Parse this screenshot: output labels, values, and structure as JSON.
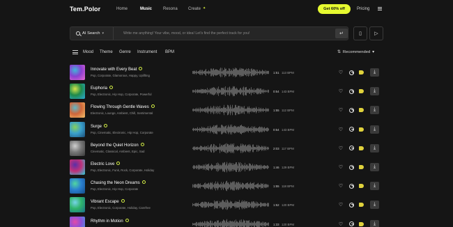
{
  "header": {
    "logo": "Tem.Polor",
    "nav": [
      "Home",
      "Music",
      "Resona",
      "Create"
    ],
    "active_nav": "Music",
    "promo": "Get 60% off",
    "pricing": "Pricing"
  },
  "search": {
    "mode": "AI Search",
    "placeholder": "Write me anything! Your vibe, mood, or idea! Let's find the perfect track for you!"
  },
  "filters": [
    "Mood",
    "Theme",
    "Genre",
    "Instrument",
    "BPM"
  ],
  "sort": "Recommended",
  "tracks": [
    {
      "title": "Innovate with Every Beat",
      "tags": "Pop, Corporate, Glamorous, Happy, Uplifting",
      "duration": "1:51",
      "bpm": "113 BPM",
      "cover": [
        "#8a3fd1",
        "#3fb8d8",
        "#e86bd0"
      ]
    },
    {
      "title": "Euphoria",
      "tags": "Pop, Electronic, Hip Hop, Corporate, Powerful",
      "duration": "0:54",
      "bpm": "143 BPM",
      "cover": [
        "#1f8a4a",
        "#d4e44a",
        "#2aa8d6"
      ]
    },
    {
      "title": "Flowing Through Gentle Waves",
      "tags": "Electronic, Lounge, Ambient, Chill, Sentimental",
      "duration": "1:55",
      "bpm": "112 BPM",
      "cover": [
        "#d0663a",
        "#5fb7c8",
        "#f2c16a"
      ]
    },
    {
      "title": "Surge",
      "tags": "Pop, Cinematic, Electronic, Hip Hop, Corporate",
      "duration": "0:54",
      "bpm": "143 BPM",
      "cover": [
        "#3aa0cc",
        "#86d05c",
        "#1c4f7a"
      ]
    },
    {
      "title": "Beyond the Quiet Horizon",
      "tags": "Cinematic, Classical, Ambient, Epic, Sad",
      "duration": "2:03",
      "bpm": "117 BPM",
      "cover": [
        "#777777",
        "#cfcfcf",
        "#3a3a3a"
      ]
    },
    {
      "title": "Electric Love",
      "tags": "Pop, Electronic, Funk, Rock, Corporate, Holiday",
      "duration": "1:46",
      "bpm": "129 BPM",
      "cover": [
        "#c0307a",
        "#5a2fa8",
        "#2ad0d8"
      ]
    },
    {
      "title": "Chasing the Neon Dreams",
      "tags": "Pop, Electronic, Hip Hop, Corporate",
      "duration": "1:55",
      "bpm": "118 BPM",
      "cover": [
        "#2a7fd0",
        "#52d6a0",
        "#154e8a"
      ]
    },
    {
      "title": "Vibrant Escape",
      "tags": "Pop, Electronic, Corporate, Holiday, Carefree",
      "duration": "1:52",
      "bpm": "120 BPM",
      "cover": [
        "#2fb36a",
        "#76d4e8",
        "#1a6f8a"
      ]
    },
    {
      "title": "Rhythm in Motion",
      "tags": "",
      "duration": "1:33",
      "bpm": "120 BPM",
      "cover": [
        "#8a4fd8",
        "#e34ba8",
        "#3aa7e0"
      ]
    }
  ],
  "colors": {
    "accent": "#e6fa30",
    "background": "#151515"
  },
  "icons": [
    "menu-icon",
    "search-icon",
    "enter-icon",
    "document-icon",
    "video-icon",
    "sliders-icon",
    "sort-icon",
    "heart-icon",
    "share-icon",
    "tag-icon",
    "download-icon",
    "verified-icon"
  ]
}
